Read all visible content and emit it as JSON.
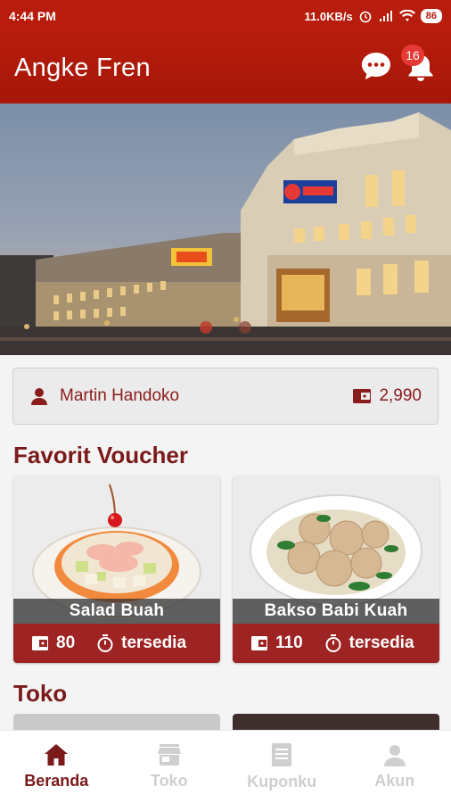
{
  "status_bar": {
    "time": "4:44 PM",
    "network_speed": "11.0KB/s",
    "battery": "86"
  },
  "app_bar": {
    "title": "Angke Fren",
    "notification_count": "16",
    "icons": [
      "chat-icon",
      "bell-icon"
    ]
  },
  "user": {
    "name": "Martin Handoko",
    "points": "2,990"
  },
  "favorites": {
    "title": "Favorit Voucher",
    "vouchers": [
      {
        "name": "Salad Buah",
        "points": "80",
        "status": "tersedia"
      },
      {
        "name": "Bakso Babi Kuah",
        "points": "110",
        "status": "tersedia"
      }
    ]
  },
  "toko": {
    "title": "Toko"
  },
  "bottom_nav": [
    {
      "label": "Beranda",
      "icon": "home-icon",
      "active": true
    },
    {
      "label": "Toko",
      "icon": "store-icon",
      "active": false
    },
    {
      "label": "Kuponku",
      "icon": "coupon-icon",
      "active": false
    },
    {
      "label": "Akun",
      "icon": "account-icon",
      "active": false
    }
  ],
  "colors": {
    "primary": "#b71c0c",
    "accent_dark": "#7a1a1a",
    "voucher_footer": "#9e2323",
    "inactive_nav": "#cfcfcf"
  }
}
